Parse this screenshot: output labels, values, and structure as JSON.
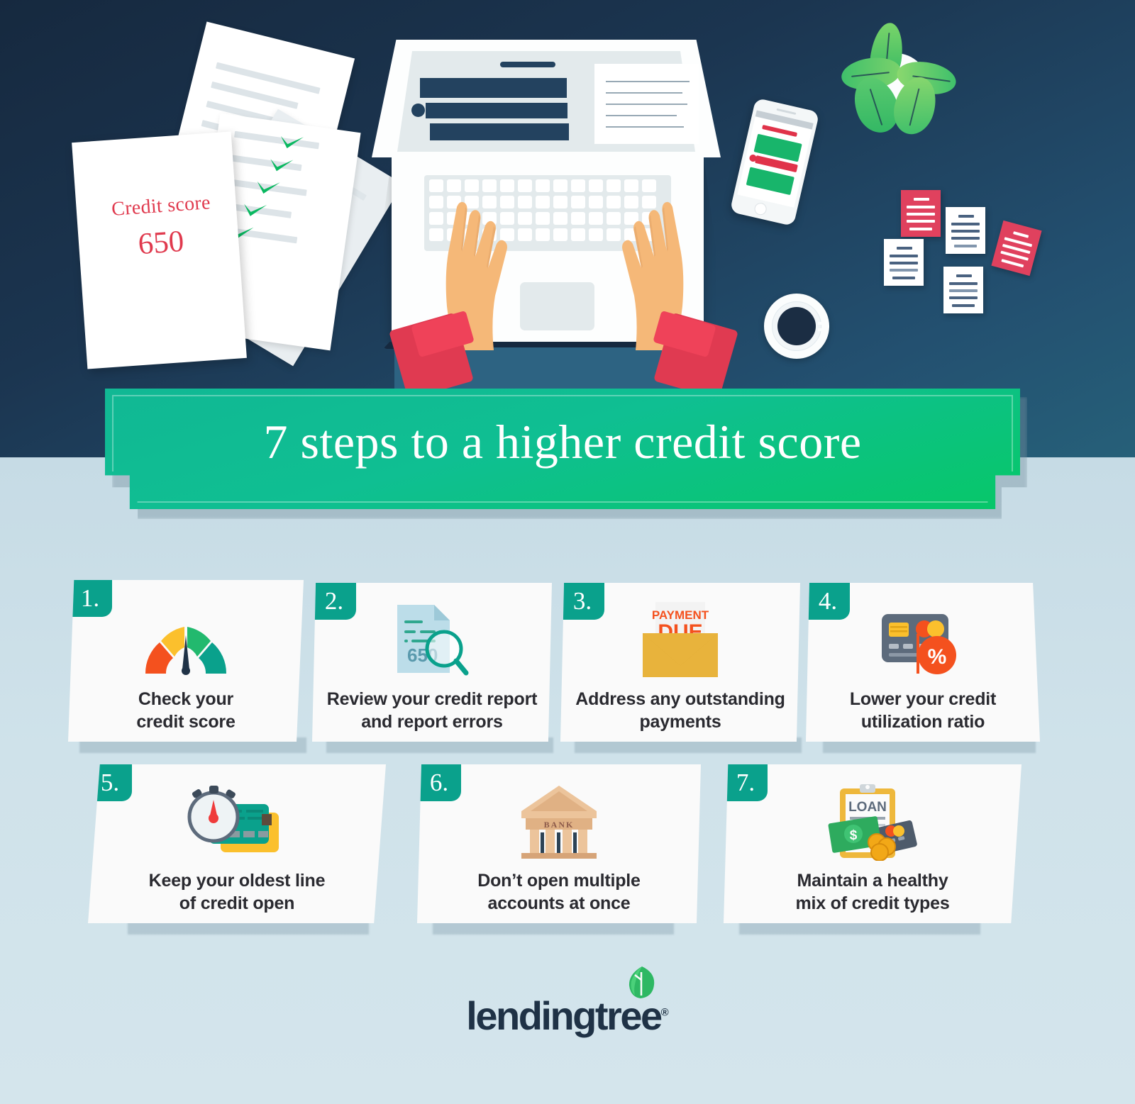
{
  "hero": {
    "paper_note": {
      "label": "Credit score",
      "value": "650"
    },
    "laptop": {
      "name": "laptop-illustration"
    },
    "phone": {
      "name": "smartphone-illustration"
    },
    "plant": {
      "name": "potted-plant-illustration"
    },
    "coffee": {
      "name": "coffee-cup-illustration"
    },
    "sticky_notes_count": 5,
    "checkmarks_count": 5
  },
  "banner": {
    "title": "7 steps to a higher credit score",
    "color": "#0fbf92",
    "accent": "#07c768"
  },
  "steps": [
    {
      "number": "1.",
      "label_line1": "Check your",
      "label_line2": "credit score",
      "icon": "credit-gauge-icon"
    },
    {
      "number": "2.",
      "label_line1": "Review your credit report",
      "label_line2": "and report errors",
      "icon": "document-magnifier-icon"
    },
    {
      "number": "3.",
      "label_line1": "Address any outstanding",
      "label_line2": "payments",
      "icon": "payment-due-envelope-icon"
    },
    {
      "number": "4.",
      "label_line1": "Lower your credit",
      "label_line2": "utilization ratio",
      "icon": "credit-card-percent-icon"
    },
    {
      "number": "5.",
      "label_line1": "Keep your oldest line",
      "label_line2": "of credit open",
      "icon": "stopwatch-credit-card-icon"
    },
    {
      "number": "6.",
      "label_line1": "Don’t open multiple",
      "label_line2": "accounts at once",
      "icon": "bank-building-icon"
    },
    {
      "number": "7.",
      "label_line1": "Maintain a healthy",
      "label_line2": "mix of credit types",
      "icon": "loan-clipboard-money-icon"
    }
  ],
  "icon_text": {
    "document_score": "650",
    "payment_line1": "PAYMENT",
    "payment_line2": "DUE",
    "card_percent": "%",
    "bank_name": "BANK",
    "loan_title": "LOAN",
    "dollar_sign": "$"
  },
  "footer": {
    "brand": "lendingtree",
    "registered_mark": "®",
    "leaf_icon": "leaf-icon",
    "brand_color": "#1f3246",
    "leaf_color": "#22b760"
  },
  "palette": {
    "hero_dark": "#16293f",
    "hero_blue": "#266079",
    "page_bg": "#cfe2ea",
    "teal": "#0aa18c",
    "red": "#e03a51",
    "orange": "#f4511e",
    "yellow": "#fbc02d",
    "green": "#22b760",
    "card_bg": "#fafafa",
    "text_dark": "#2a2a30"
  }
}
